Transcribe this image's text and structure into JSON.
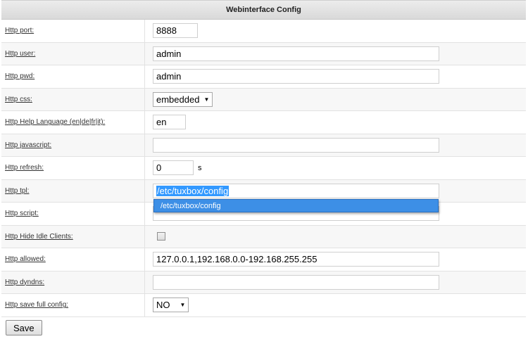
{
  "panel": {
    "title": "Webinterface Config"
  },
  "fields": {
    "port": {
      "label": "Http port:",
      "value": "8888"
    },
    "user": {
      "label": "Http user:",
      "value": "admin"
    },
    "pwd": {
      "label": "Http pwd:",
      "value": "admin"
    },
    "css": {
      "label": "Http css:",
      "value": "embedded"
    },
    "help_lang": {
      "label": "Http Help Language (en|de|fr|it):",
      "value": "en"
    },
    "javascript": {
      "label": "Http javascript:",
      "value": ""
    },
    "refresh": {
      "label": "Http refresh:",
      "value": "0",
      "unit": "s"
    },
    "tpl": {
      "label": "Http tpl:",
      "value": "/etc/tuxbox/config",
      "suggestion": "/etc/tuxbox/config"
    },
    "script": {
      "label": "Http script:",
      "value": ""
    },
    "hide_idle": {
      "label": "Http Hide Idle Clients:",
      "checked": false
    },
    "allowed": {
      "label": "Http allowed:",
      "value": "127.0.0.1,192.168.0.0-192.168.255.255"
    },
    "dyndns": {
      "label": "Http dyndns:",
      "value": ""
    },
    "save_full": {
      "label": "Http save full config:",
      "value": "NO"
    }
  },
  "actions": {
    "save_label": "Save"
  }
}
